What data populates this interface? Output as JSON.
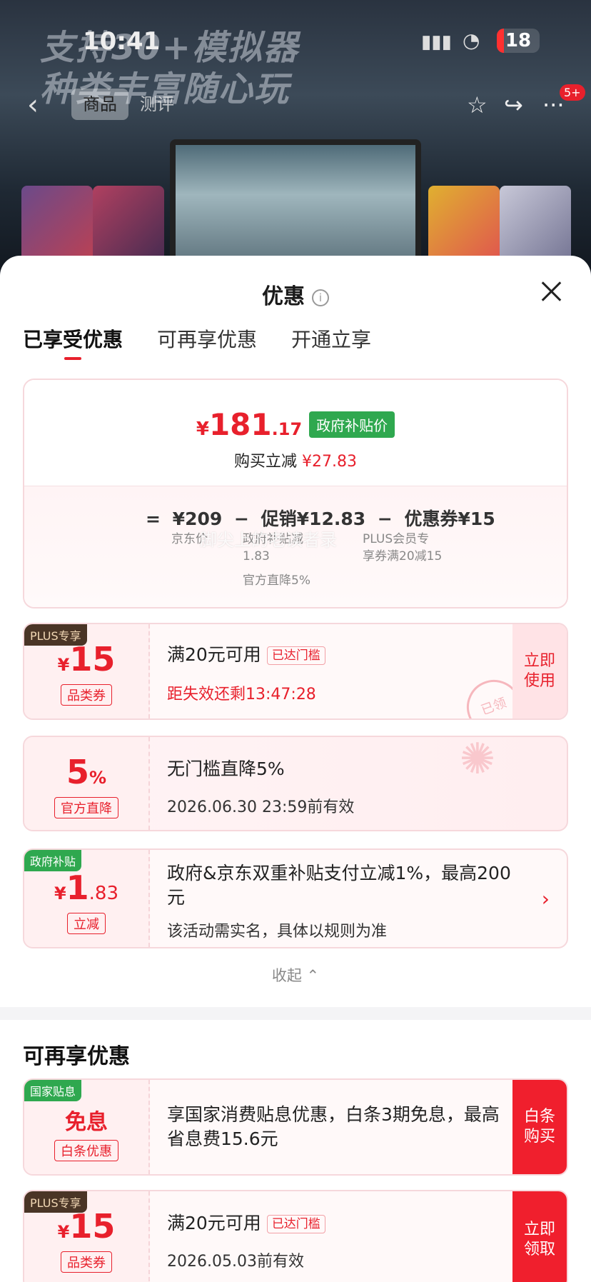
{
  "status_bar": {
    "time": "10:41",
    "battery": "18"
  },
  "banner": {
    "promo_line1": "支持30+模拟器",
    "promo_line2": "种类丰富随心玩"
  },
  "nav": {
    "tab_product": "商品",
    "tab_review": "测评",
    "badge": "5+"
  },
  "sheet": {
    "title": "优惠",
    "tabs": [
      "已享受优惠",
      "可再享优惠",
      "开通立享"
    ]
  },
  "summary": {
    "price_yen": "¥",
    "price_int": "181",
    "price_dec": ".17",
    "price_tag": "政府补贴价",
    "reduce_label": "购买立减",
    "reduce_amount": "¥27.83",
    "calc": {
      "eq": "=",
      "base": "¥209",
      "minus1": "−",
      "promo": "促销¥12.83",
      "minus2": "−",
      "coupon": "优惠券¥15",
      "base_label": "京东价",
      "promo_label1": "政府补贴减",
      "promo_label2": "1.83",
      "promo_label3": "官方直降5%",
      "coupon_label1": "PLUS会员专",
      "coupon_label2": "享券满20减15"
    }
  },
  "watermark": "脚尖上的老读者录",
  "coupons": [
    {
      "corner": "PLUS专享",
      "yen": "¥",
      "value": "15",
      "tag": "品类券",
      "title": "满20元可用",
      "threshold": "已达门槛",
      "sub": "距失效还剩13:47:28",
      "action": "立即使用",
      "stamp": "已领"
    },
    {
      "value": "5",
      "unit": "%",
      "tag": "官方直降",
      "title": "无门槛直降5%",
      "sub": "2026.06.30 23:59前有效"
    },
    {
      "corner": "政府补贴",
      "yen": "¥",
      "value": "1",
      "dec": ".83",
      "tag": "立减",
      "title": "政府&京东双重补贴支付立减1%，最高200元",
      "sub": "该活动需实名，具体以规则为准"
    }
  ],
  "collapse_label": "收起",
  "section2": {
    "title": "可再享优惠",
    "items": [
      {
        "corner": "国家贴息",
        "value": "免息",
        "tag": "白条优惠",
        "title": "享国家消费贴息优惠，白条3期免息，最高省息费15.6元",
        "action": "白条购买"
      },
      {
        "corner": "PLUS专享",
        "yen": "¥",
        "value": "15",
        "tag": "品类券",
        "title": "满20元可用",
        "threshold": "已达门槛",
        "sub": "2026.05.03前有效",
        "action": "立即领取"
      }
    ]
  }
}
